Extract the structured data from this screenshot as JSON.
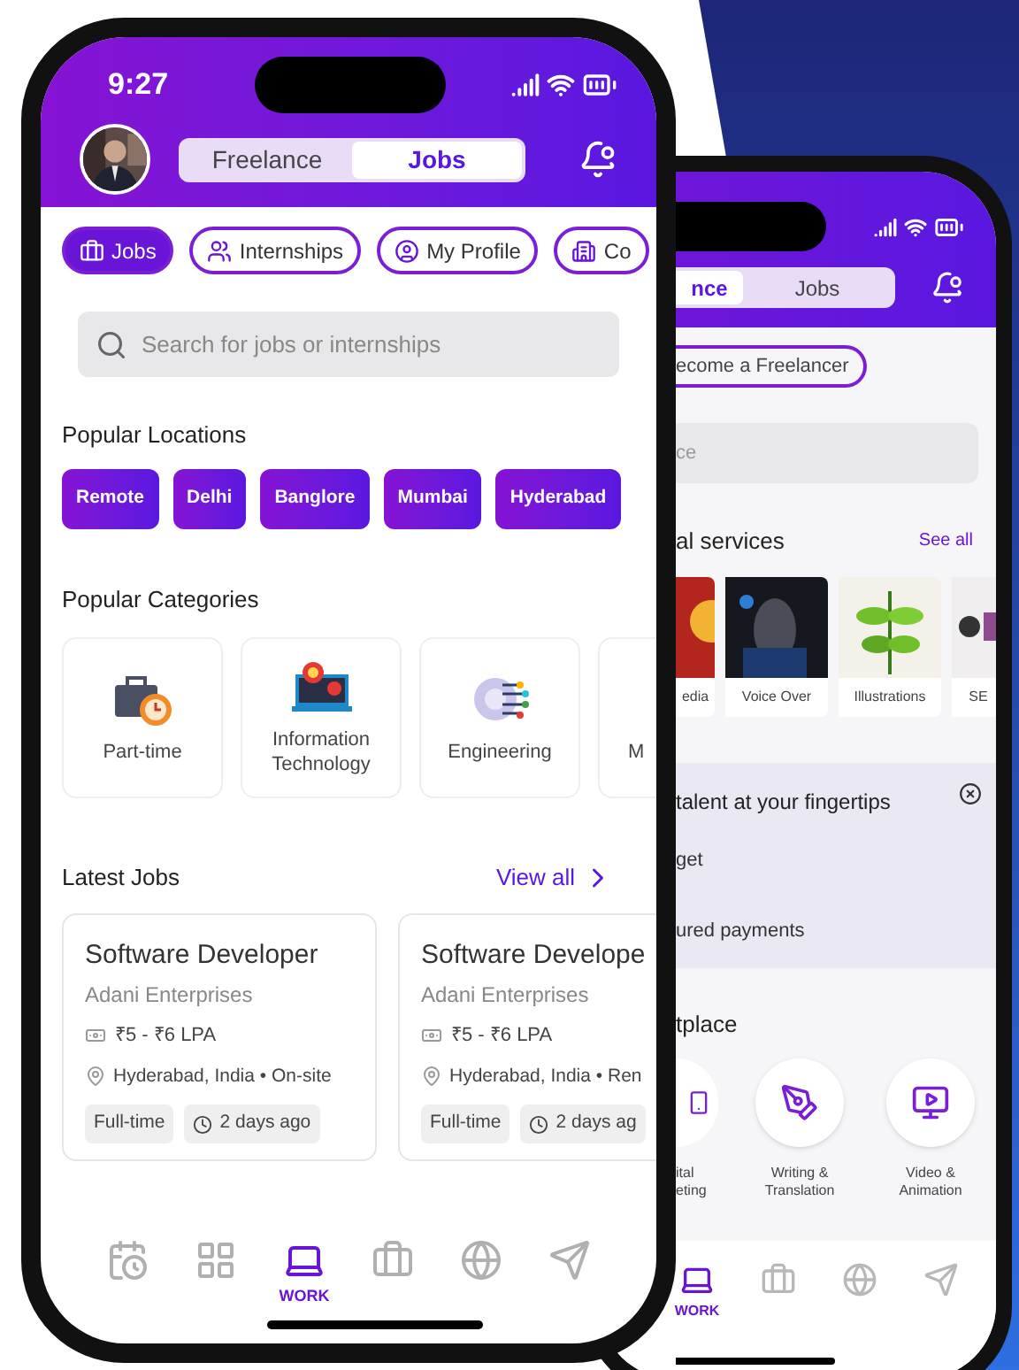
{
  "front_phone": {
    "status_bar": {
      "time": "9:27"
    },
    "mode_tabs": [
      {
        "label": "Freelance",
        "selected": false
      },
      {
        "label": "Jobs",
        "selected": true
      }
    ],
    "nav_chips": [
      {
        "label": "Jobs",
        "selected": true
      },
      {
        "label": "Internships",
        "selected": false
      },
      {
        "label": "My Profile",
        "selected": false
      },
      {
        "label": "Co",
        "selected": false
      }
    ],
    "search": {
      "placeholder": "Search for jobs or internships"
    },
    "popular_locations": {
      "title": "Popular Locations",
      "items": [
        "Remote",
        "Delhi",
        "Banglore",
        "Mumbai",
        "Hyderabad"
      ]
    },
    "popular_categories": {
      "title": "Popular Categories",
      "items": [
        "Part-time",
        "Information Technology",
        "Engineering",
        "M"
      ]
    },
    "latest_jobs": {
      "title": "Latest Jobs",
      "link": "View all",
      "jobs": [
        {
          "title": "Software Developer",
          "company": "Adani Enterprises",
          "salary": "₹5 - ₹6 LPA",
          "location": "Hyderabad, India • On-site",
          "type": "Full-time",
          "posted": "2 days ago"
        },
        {
          "title": "Software Develope",
          "company": "Adani Enterprises",
          "salary": "₹5 - ₹6 LPA",
          "location": "Hyderabad, India • Ren",
          "type": "Full-time",
          "posted": "2 days ag"
        }
      ]
    },
    "tab_bar": [
      {
        "selected": false
      },
      {
        "selected": false
      },
      {
        "label": "WORK",
        "selected": true
      },
      {
        "selected": false
      },
      {
        "selected": false
      },
      {
        "selected": false
      }
    ]
  },
  "back_phone": {
    "mode_tabs": [
      {
        "label": "nce",
        "selected": true
      },
      {
        "label": "Jobs",
        "selected": false
      }
    ],
    "become_button": "ecome a Freelancer",
    "search": {
      "placeholder": "ce"
    },
    "services": {
      "title": "al services",
      "link": "See all",
      "items": [
        "edia",
        "Voice Over",
        "Illustrations",
        "SE"
      ]
    },
    "banner": {
      "title": "talent at your fingertips",
      "points": [
        "get",
        "ured payments"
      ]
    },
    "marketplace": {
      "title": "tplace",
      "items": [
        {
          "lines": [
            "ital",
            "eting"
          ]
        },
        {
          "lines": [
            "Writing &",
            "Translation"
          ]
        },
        {
          "lines": [
            "Video &",
            "Animation"
          ]
        }
      ]
    },
    "tab_bar": [
      {
        "label": "WORK",
        "selected": true
      },
      {
        "selected": false
      },
      {
        "selected": false
      },
      {
        "selected": false
      }
    ]
  }
}
